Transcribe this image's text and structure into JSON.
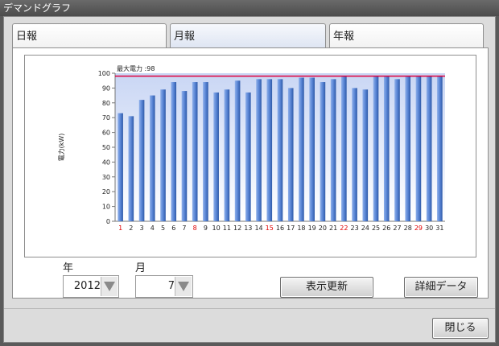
{
  "window": {
    "title": "デマンドグラフ"
  },
  "tabs": [
    {
      "label": "日報"
    },
    {
      "label": "月報"
    },
    {
      "label": "年報"
    }
  ],
  "chart_data": {
    "type": "bar",
    "ylabel": "電力(kW)",
    "max_label": "最大電力 :98",
    "max_value": 98,
    "ylim": [
      0,
      100
    ],
    "yticks": [
      0,
      10,
      20,
      30,
      40,
      50,
      60,
      70,
      80,
      90,
      100
    ],
    "categories": [
      "1",
      "2",
      "3",
      "4",
      "5",
      "6",
      "7",
      "8",
      "9",
      "10",
      "11",
      "12",
      "13",
      "14",
      "15",
      "16",
      "17",
      "18",
      "19",
      "20",
      "21",
      "22",
      "23",
      "24",
      "25",
      "26",
      "27",
      "28",
      "29",
      "30",
      "31"
    ],
    "highlight_days": [
      "1",
      "8",
      "15",
      "22",
      "29"
    ],
    "values": [
      73,
      71,
      82,
      85,
      89,
      94,
      88,
      94,
      94,
      87,
      89,
      95,
      87,
      96,
      96,
      96,
      90,
      97,
      97,
      94,
      96,
      98,
      90,
      89,
      98,
      98,
      96,
      98,
      98,
      98,
      98
    ],
    "colors": {
      "bar": "#5a86d6",
      "bar_dark": "#2f5aa8",
      "max_line": "#e0003c",
      "holiday_label": "#e00000"
    }
  },
  "controls": {
    "year_label": "年",
    "month_label": "月",
    "year_value": "2012",
    "month_value": "7",
    "refresh_button": "表示更新",
    "detail_button": "詳細データ",
    "close_button": "閉じる"
  }
}
